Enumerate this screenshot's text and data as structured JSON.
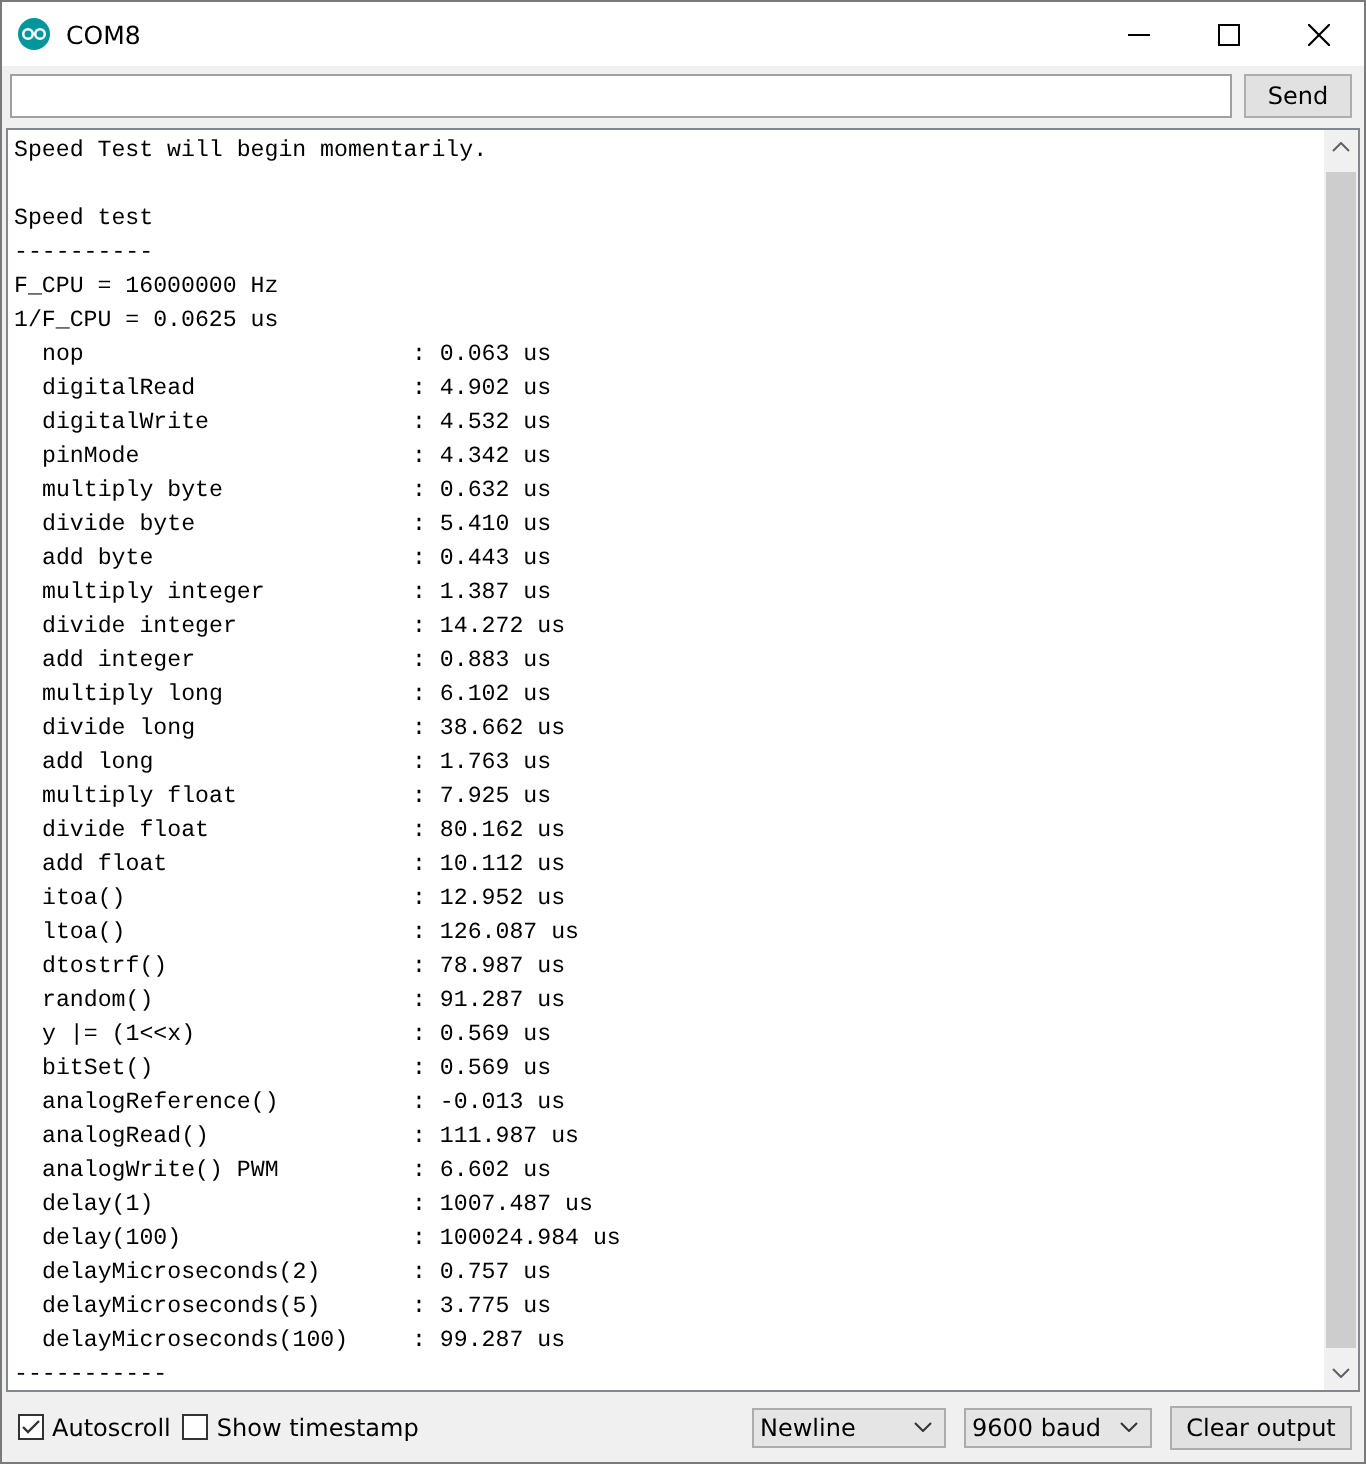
{
  "window": {
    "title": "COM8"
  },
  "send_bar": {
    "button": "Send"
  },
  "output": {
    "intro": "Speed Test will begin momentarily.",
    "lines": [
      "Speed test",
      "----------",
      "F_CPU = 16000000 Hz",
      "1/F_CPU = 0.0625 us"
    ],
    "results": [
      {
        "name": "nop",
        "value": ": 0.063 us"
      },
      {
        "name": "digitalRead",
        "value": ": 4.902 us"
      },
      {
        "name": "digitalWrite",
        "value": ": 4.532 us"
      },
      {
        "name": "pinMode",
        "value": ": 4.342 us"
      },
      {
        "name": "multiply byte",
        "value": ": 0.632 us"
      },
      {
        "name": "divide byte",
        "value": ": 5.410 us"
      },
      {
        "name": "add byte",
        "value": ": 0.443 us"
      },
      {
        "name": "multiply integer",
        "value": ": 1.387 us"
      },
      {
        "name": "divide integer",
        "value": ": 14.272 us"
      },
      {
        "name": "add integer",
        "value": ": 0.883 us"
      },
      {
        "name": "multiply long",
        "value": ": 6.102 us"
      },
      {
        "name": "divide long",
        "value": ": 38.662 us"
      },
      {
        "name": "add long",
        "value": ": 1.763 us"
      },
      {
        "name": "multiply float",
        "value": ": 7.925 us"
      },
      {
        "name": "divide float",
        "value": ": 80.162 us"
      },
      {
        "name": "add float",
        "value": ": 10.112 us"
      },
      {
        "name": "itoa()",
        "value": ": 12.952 us"
      },
      {
        "name": "ltoa()",
        "value": ": 126.087 us"
      },
      {
        "name": "dtostrf()",
        "value": ": 78.987 us"
      },
      {
        "name": "random()",
        "value": ": 91.287 us"
      },
      {
        "name": "y |= (1<<x)",
        "value": ": 0.569 us"
      },
      {
        "name": "bitSet()",
        "value": ": 0.569 us"
      },
      {
        "name": "analogReference()",
        "value": ": -0.013 us"
      },
      {
        "name": "analogRead()",
        "value": ": 111.987 us"
      },
      {
        "name": "analogWrite() PWM",
        "value": ": 6.602 us"
      },
      {
        "name": "delay(1)",
        "value": ": 1007.487 us"
      },
      {
        "name": "delay(100)",
        "value": ": 100024.984 us"
      },
      {
        "name": "delayMicroseconds(2)",
        "value": ": 0.757 us"
      },
      {
        "name": "delayMicroseconds(5)",
        "value": ": 3.775 us"
      },
      {
        "name": "delayMicroseconds(100)",
        "value": ": 99.287 us"
      }
    ],
    "footer": "-----------"
  },
  "bottom_bar": {
    "checkboxes": [
      {
        "label": "Autoscroll",
        "checked": true
      },
      {
        "label": "Show timestamp",
        "checked": false
      }
    ],
    "line_ending": "Newline",
    "baud": "9600 baud",
    "clear_button": "Clear output"
  }
}
